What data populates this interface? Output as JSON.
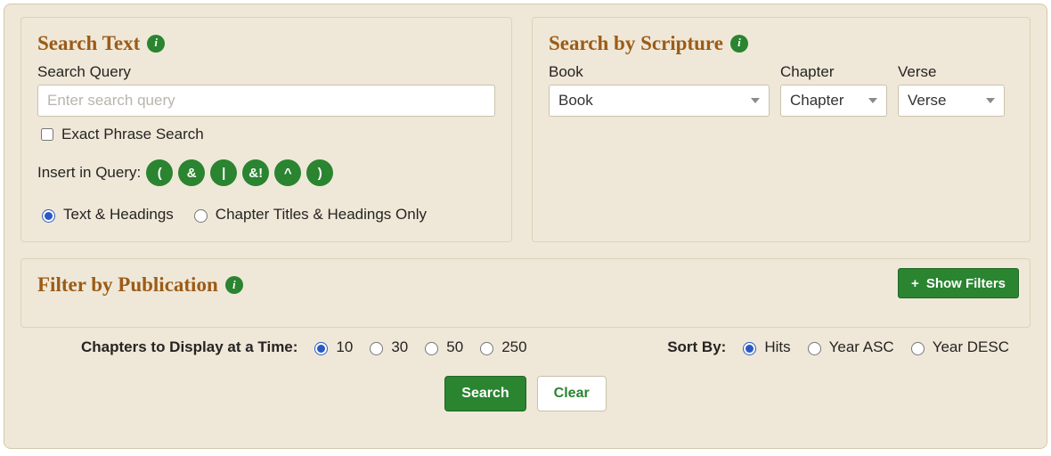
{
  "searchText": {
    "title": "Search Text",
    "queryLabel": "Search Query",
    "queryPlaceholder": "Enter search query",
    "exactPhraseLabel": "Exact Phrase Search",
    "insertLabel": "Insert in Query:",
    "operators": [
      "(",
      "&",
      "|",
      "&!",
      "^",
      ")"
    ],
    "scopeOptions": {
      "textHeadings": "Text & Headings",
      "titlesOnly": "Chapter Titles & Headings Only"
    }
  },
  "scripture": {
    "title": "Search by Scripture",
    "bookLabel": "Book",
    "chapterLabel": "Chapter",
    "verseLabel": "Verse",
    "bookSelected": "Book",
    "chapterSelected": "Chapter",
    "verseSelected": "Verse"
  },
  "filter": {
    "title": "Filter by Publication",
    "showFiltersLabel": "Show Filters"
  },
  "options": {
    "chaptersLabel": "Chapters to Display at a Time:",
    "chaptersValues": [
      "10",
      "30",
      "50",
      "250"
    ],
    "sortLabel": "Sort By:",
    "sortValues": {
      "hits": "Hits",
      "yearAsc": "Year ASC",
      "yearDesc": "Year DESC"
    }
  },
  "actions": {
    "search": "Search",
    "clear": "Clear"
  }
}
